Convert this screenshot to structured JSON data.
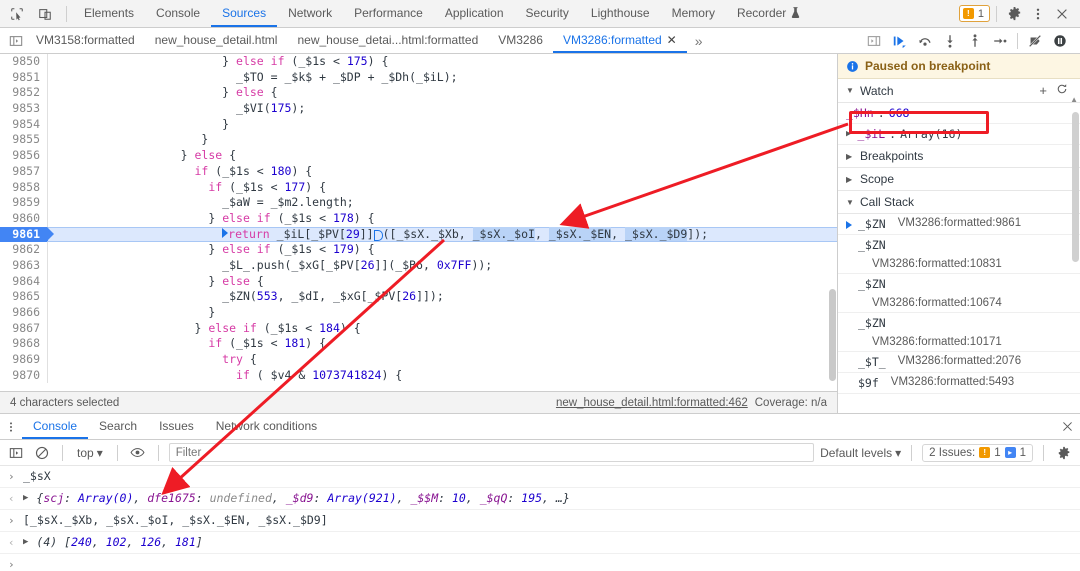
{
  "topbar": {
    "icons": [
      {
        "name": "inspect-element-icon"
      },
      {
        "name": "device-toolbar-icon"
      }
    ],
    "tabs": [
      {
        "label": "Elements",
        "active": false
      },
      {
        "label": "Console",
        "active": false
      },
      {
        "label": "Sources",
        "active": true
      },
      {
        "label": "Network",
        "active": false
      },
      {
        "label": "Performance",
        "active": false
      },
      {
        "label": "Application",
        "active": false
      },
      {
        "label": "Security",
        "active": false
      },
      {
        "label": "Lighthouse",
        "active": false
      },
      {
        "label": "Memory",
        "active": false
      },
      {
        "label": "Recorder",
        "active": false,
        "icon": "recorder-flask-icon"
      }
    ],
    "issue_count": "1",
    "settings_icon": "gear-icon",
    "more_icon": "kebab-menu-icon",
    "close_icon": "close-icon"
  },
  "filetabs": {
    "nav_icon": "show-navigator-icon",
    "tabs": [
      {
        "label": "VM3158:formatted",
        "active": false,
        "closable": false
      },
      {
        "label": "new_house_detail.html",
        "active": false,
        "closable": false
      },
      {
        "label": "new_house_detai...html:formatted",
        "active": false,
        "closable": false
      },
      {
        "label": "VM3286",
        "active": false,
        "closable": false
      },
      {
        "label": "VM3286:formatted",
        "active": true,
        "closable": true
      }
    ],
    "overflow_label": "»",
    "panel_toggle_icon": "show-debugger-sidebar-icon",
    "debug_buttons": [
      {
        "name": "resume-script-execution-icon"
      },
      {
        "name": "step-over-next-function-call-icon"
      },
      {
        "name": "step-into-next-function-call-icon"
      },
      {
        "name": "step-out-of-current-function-icon"
      },
      {
        "name": "step-icon"
      },
      {
        "name": "deactivate-breakpoints-icon"
      },
      {
        "name": "pause-on-exceptions-icon"
      }
    ]
  },
  "editor": {
    "first_line": 9850,
    "current_line": 9861,
    "lines": [
      {
        "n": 9850,
        "indent": 24,
        "tokens": [
          {
            "t": "} ",
            "c": "pln"
          },
          {
            "t": "else if",
            "c": "kw2"
          },
          {
            "t": " (_$1s < ",
            "c": "pln"
          },
          {
            "t": "175",
            "c": "num"
          },
          {
            "t": ") {",
            "c": "pln"
          }
        ]
      },
      {
        "n": 9851,
        "indent": 26,
        "tokens": [
          {
            "t": "_$TO = _$k$ + _$DP + _$Dh(_$iL);",
            "c": "pln"
          }
        ]
      },
      {
        "n": 9852,
        "indent": 24,
        "tokens": [
          {
            "t": "} ",
            "c": "pln"
          },
          {
            "t": "else",
            "c": "kw2"
          },
          {
            "t": " {",
            "c": "pln"
          }
        ]
      },
      {
        "n": 9853,
        "indent": 26,
        "tokens": [
          {
            "t": "_$VI(",
            "c": "pln"
          },
          {
            "t": "175",
            "c": "num"
          },
          {
            "t": ");",
            "c": "pln"
          }
        ]
      },
      {
        "n": 9854,
        "indent": 24,
        "tokens": [
          {
            "t": "}",
            "c": "pln"
          }
        ]
      },
      {
        "n": 9855,
        "indent": 21,
        "tokens": [
          {
            "t": "}",
            "c": "pln"
          }
        ]
      },
      {
        "n": 9856,
        "indent": 18,
        "tokens": [
          {
            "t": "} ",
            "c": "pln"
          },
          {
            "t": "else",
            "c": "kw2"
          },
          {
            "t": " {",
            "c": "pln"
          }
        ]
      },
      {
        "n": 9857,
        "indent": 20,
        "tokens": [
          {
            "t": "if",
            "c": "kw2"
          },
          {
            "t": " (_$1s < ",
            "c": "pln"
          },
          {
            "t": "180",
            "c": "num"
          },
          {
            "t": ") {",
            "c": "pln"
          }
        ]
      },
      {
        "n": 9858,
        "indent": 22,
        "tokens": [
          {
            "t": "if",
            "c": "kw2"
          },
          {
            "t": " (_$1s < ",
            "c": "pln"
          },
          {
            "t": "177",
            "c": "num"
          },
          {
            "t": ") {",
            "c": "pln"
          }
        ]
      },
      {
        "n": 9859,
        "indent": 24,
        "tokens": [
          {
            "t": "_$aW = _$m2.length;",
            "c": "pln"
          }
        ]
      },
      {
        "n": 9860,
        "indent": 22,
        "tokens": [
          {
            "t": "} ",
            "c": "pln"
          },
          {
            "t": "else if",
            "c": "kw2"
          },
          {
            "t": " (_$1s < ",
            "c": "pln"
          },
          {
            "t": "178",
            "c": "num"
          },
          {
            "t": ") {",
            "c": "pln"
          }
        ]
      },
      {
        "n": 9861,
        "indent": 24,
        "current": true,
        "tokens": [
          {
            "t": "return",
            "c": "kw2"
          },
          {
            "t": " _$iL[_$PV[",
            "c": "pln"
          },
          {
            "t": "29",
            "c": "num"
          },
          {
            "t": "]]",
            "c": "pln"
          },
          {
            "t": "([_$sX._$Xb, ",
            "c": "pln"
          },
          {
            "t": "_$sX._$oI",
            "c": "sel"
          },
          {
            "t": ", ",
            "c": "pln"
          },
          {
            "t": "_$sX._$EN",
            "c": "sel"
          },
          {
            "t": ", ",
            "c": "pln"
          },
          {
            "t": "_$sX._$D9",
            "c": "sel"
          },
          {
            "t": "]);",
            "c": "pln"
          }
        ]
      },
      {
        "n": 9862,
        "indent": 22,
        "tokens": [
          {
            "t": "} ",
            "c": "pln"
          },
          {
            "t": "else if",
            "c": "kw2"
          },
          {
            "t": " (_$1s < ",
            "c": "pln"
          },
          {
            "t": "179",
            "c": "num"
          },
          {
            "t": ") {",
            "c": "pln"
          }
        ]
      },
      {
        "n": 9863,
        "indent": 24,
        "tokens": [
          {
            "t": "_$L_.push(_$xG[_$PV[",
            "c": "pln"
          },
          {
            "t": "26",
            "c": "num"
          },
          {
            "t": "]](_$B6, ",
            "c": "pln"
          },
          {
            "t": "0x7FF",
            "c": "num"
          },
          {
            "t": "));",
            "c": "pln"
          }
        ]
      },
      {
        "n": 9864,
        "indent": 22,
        "tokens": [
          {
            "t": "} ",
            "c": "pln"
          },
          {
            "t": "else",
            "c": "kw2"
          },
          {
            "t": " {",
            "c": "pln"
          }
        ]
      },
      {
        "n": 9865,
        "indent": 24,
        "tokens": [
          {
            "t": "_$ZN(",
            "c": "pln"
          },
          {
            "t": "553",
            "c": "num"
          },
          {
            "t": ", _$dI, _$xG[_$PV[",
            "c": "pln"
          },
          {
            "t": "26",
            "c": "num"
          },
          {
            "t": "]]);",
            "c": "pln"
          }
        ]
      },
      {
        "n": 9866,
        "indent": 22,
        "tokens": [
          {
            "t": "}",
            "c": "pln"
          }
        ]
      },
      {
        "n": 9867,
        "indent": 20,
        "tokens": [
          {
            "t": "} ",
            "c": "pln"
          },
          {
            "t": "else if",
            "c": "kw2"
          },
          {
            "t": " (_$1s < ",
            "c": "pln"
          },
          {
            "t": "184",
            "c": "num"
          },
          {
            "t": ") {",
            "c": "pln"
          }
        ]
      },
      {
        "n": 9868,
        "indent": 22,
        "tokens": [
          {
            "t": "if",
            "c": "kw2"
          },
          {
            "t": " (_$1s < ",
            "c": "pln"
          },
          {
            "t": "181",
            "c": "num"
          },
          {
            "t": ") {",
            "c": "pln"
          }
        ]
      },
      {
        "n": 9869,
        "indent": 24,
        "tokens": [
          {
            "t": "try",
            "c": "kw2"
          },
          {
            "t": " {",
            "c": "pln"
          }
        ]
      },
      {
        "n": 9870,
        "indent": 26,
        "tokens": [
          {
            "t": "if",
            "c": "kw2"
          },
          {
            "t": " ( $v4 & ",
            "c": "pln"
          },
          {
            "t": "1073741824",
            "c": "num"
          },
          {
            "t": ") {",
            "c": "pln"
          }
        ]
      }
    ]
  },
  "status": {
    "selection_text": "4 characters selected",
    "source_link": "new_house_detail.html:formatted:462",
    "coverage": "Coverage: n/a"
  },
  "debugger": {
    "paused_message": "Paused on breakpoint",
    "paused_icon": "info-circle-icon",
    "watch": {
      "title": "Watch",
      "add_icon": "plus-icon",
      "refresh_icon": "refresh-icon",
      "expanded": true,
      "items": [
        {
          "name": "_$Hn",
          "value": "668",
          "expandable": false,
          "highlighted": true
        },
        {
          "name": "_$iL",
          "value": "Array(16)",
          "expandable": true,
          "highlighted": false
        }
      ]
    },
    "sections": [
      {
        "title": "Breakpoints",
        "expanded": false
      },
      {
        "title": "Scope",
        "expanded": false
      }
    ],
    "call_stack": {
      "title": "Call Stack",
      "expanded": true,
      "frames": [
        {
          "fn": "_$ZN",
          "loc": "VM3286:formatted:9861",
          "current": true,
          "wrap": false
        },
        {
          "fn": "_$ZN",
          "loc": "VM3286:formatted:10831",
          "current": false,
          "wrap": true
        },
        {
          "fn": "_$ZN",
          "loc": "VM3286:formatted:10674",
          "current": false,
          "wrap": true
        },
        {
          "fn": "_$ZN",
          "loc": "VM3286:formatted:10171",
          "current": false,
          "wrap": true
        },
        {
          "fn": "_$T_",
          "loc": "VM3286:formatted:2076",
          "current": false,
          "wrap": false
        },
        {
          "fn": "$9f",
          "loc": "VM3286:formatted:5493",
          "current": false,
          "wrap": false
        }
      ]
    }
  },
  "drawer": {
    "kebab_icon": "kebab-menu-icon",
    "tabs": [
      {
        "label": "Console",
        "active": true
      },
      {
        "label": "Search",
        "active": false
      },
      {
        "label": "Issues",
        "active": false
      },
      {
        "label": "Network conditions",
        "active": false
      }
    ],
    "close_icon": "close-icon",
    "toolbar": {
      "sidebar_icon": "console-sidebar-icon",
      "clear_icon": "clear-console-icon",
      "context": "top",
      "eye_icon": "live-expression-icon",
      "filter_placeholder": "Filter",
      "filter_value": "",
      "levels": "Default levels",
      "issues_label": "2 Issues:",
      "issue_warning_count": "1",
      "issue_info_count": "1",
      "settings_icon": "gear-icon"
    },
    "log": [
      {
        "kind": "input",
        "parts": [
          {
            "t": "_$sX",
            "c": "pln"
          }
        ]
      },
      {
        "kind": "output",
        "expandable": true,
        "parts": [
          {
            "t": "{",
            "c": "it"
          },
          {
            "t": "scj",
            "c": "prop"
          },
          {
            "t": ": ",
            "c": "it"
          },
          {
            "t": "Array(0)",
            "c": "nums"
          },
          {
            "t": ", ",
            "c": "it"
          },
          {
            "t": "dfe1675",
            "c": "prop"
          },
          {
            "t": ": ",
            "c": "it"
          },
          {
            "t": "undefined",
            "c": "gray"
          },
          {
            "t": ", ",
            "c": "it"
          },
          {
            "t": "_$d9",
            "c": "prop"
          },
          {
            "t": ": ",
            "c": "it"
          },
          {
            "t": "Array(921)",
            "c": "nums"
          },
          {
            "t": ", ",
            "c": "it"
          },
          {
            "t": "_$$M",
            "c": "prop"
          },
          {
            "t": ": ",
            "c": "it"
          },
          {
            "t": "10",
            "c": "nums"
          },
          {
            "t": ", ",
            "c": "it"
          },
          {
            "t": "_$qQ",
            "c": "prop"
          },
          {
            "t": ": ",
            "c": "it"
          },
          {
            "t": "195",
            "c": "nums"
          },
          {
            "t": ", …}",
            "c": "it"
          }
        ]
      },
      {
        "kind": "input",
        "parts": [
          {
            "t": "[_$sX._$Xb, _$sX._$oI, _$sX._$EN, _$sX._$D9]",
            "c": "pln"
          }
        ]
      },
      {
        "kind": "output",
        "expandable": true,
        "parts": [
          {
            "t": "(4) ",
            "c": "it"
          },
          {
            "t": "[",
            "c": "it"
          },
          {
            "t": "240",
            "c": "nums"
          },
          {
            "t": ", ",
            "c": "it"
          },
          {
            "t": "102",
            "c": "nums"
          },
          {
            "t": ", ",
            "c": "it"
          },
          {
            "t": "126",
            "c": "nums"
          },
          {
            "t": ", ",
            "c": "it"
          },
          {
            "t": "181",
            "c": "nums"
          },
          {
            "t": "]",
            "c": "it"
          }
        ]
      },
      {
        "kind": "prompt",
        "parts": []
      }
    ]
  },
  "annotations": {
    "highlight_color": "#ee1c25",
    "arrows": [
      {
        "name": "arrow-watch-to-code"
      },
      {
        "name": "arrow-code-to-console"
      }
    ]
  }
}
